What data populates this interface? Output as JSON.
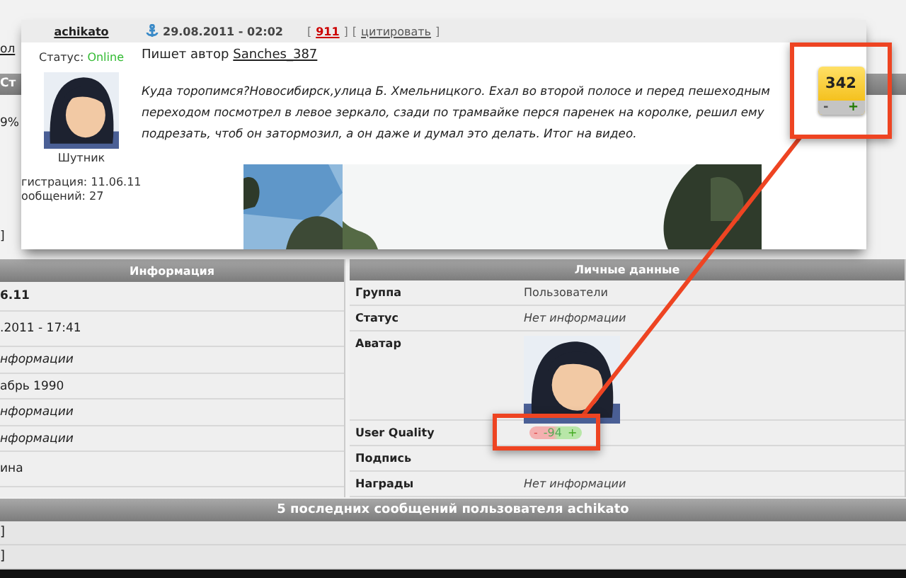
{
  "background_page": {
    "fragments": [
      {
        "text": "ол",
        "kind": "link"
      },
      {
        "text": "Ст",
        "kind": "bar"
      },
      {
        "text": "9%",
        "kind": "plain"
      },
      {
        "text": "]",
        "kind": "plain"
      }
    ]
  },
  "post": {
    "author": "achikato",
    "status_label": "Статус:",
    "status": "Online",
    "rank": "Шутник",
    "registration": "гистрация: 11.06.11",
    "posts_count": "ообщений: 27",
    "date": "29.08.2011 - 02:02",
    "bracket_open": "[",
    "bracket_close": "]",
    "post_number": "911",
    "quote_link": "цитировать",
    "quote_author_prefix": "Пишет автор",
    "quote_author": "Sanches_387",
    "text": "Куда торопимся?Новосибирск,улица Б. Хмельницкого. Ехал во второй полосе и перед пешеходным переходом посмотрел в левое зеркало, сзади по трамвайке перся паренек на королке, решил ему подрезать, чтоб он затормозил, а он даже и думал это делать. Итог на видео.",
    "rating": {
      "value": "342",
      "minus": "-",
      "plus": "+"
    }
  },
  "info_table": {
    "title": "Информация",
    "rows": [
      {
        "text": "6.11",
        "bold": true
      },
      {
        "text": ".2011 - 17:41",
        "bold": false
      },
      {
        "text": "нформации",
        "bold": false,
        "italic": true
      },
      {
        "text": "абрь 1990",
        "bold": false
      },
      {
        "text": "нформации",
        "bold": false,
        "italic": true
      },
      {
        "text": "нформации",
        "bold": false,
        "italic": true
      },
      {
        "text": "ина",
        "bold": false
      }
    ]
  },
  "personal_table": {
    "title": "Личные данные",
    "rows": [
      {
        "label": "Группа",
        "kind": "text",
        "value": "Пользователи"
      },
      {
        "label": "Статус",
        "kind": "italic",
        "value": "Нет информации"
      },
      {
        "label": "Аватар",
        "kind": "avatar"
      },
      {
        "label": "User Quality",
        "kind": "rating",
        "minus": "-",
        "value": "-94",
        "plus": "+"
      },
      {
        "label": "Подпись",
        "kind": "empty"
      },
      {
        "label": "Награды",
        "kind": "italic",
        "value": "Нет информации"
      }
    ]
  },
  "recent_posts": {
    "title": "5 последних сообщений пользователя achikato",
    "rows": [
      "]",
      "]"
    ]
  }
}
